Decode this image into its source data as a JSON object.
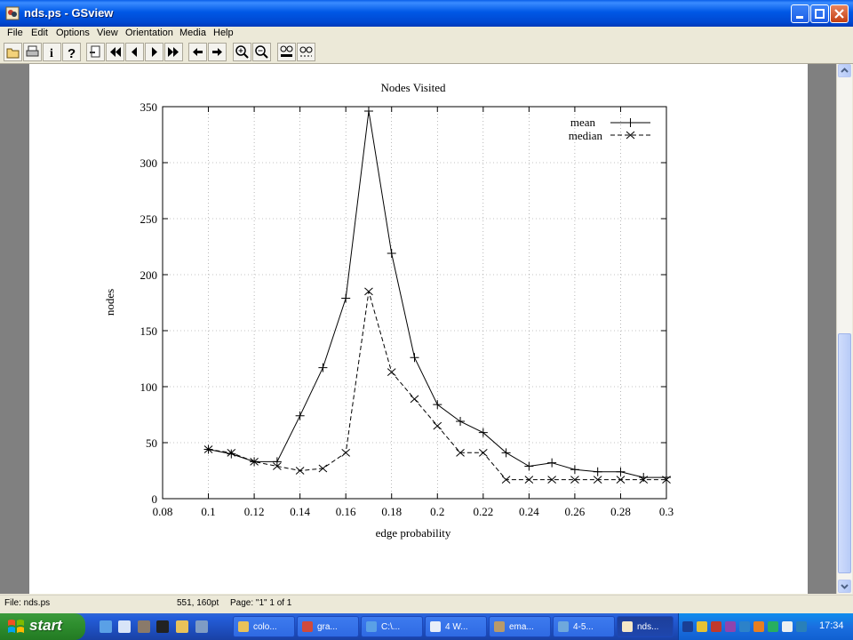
{
  "window": {
    "title": "nds.ps - GSview",
    "menu": [
      "File",
      "Edit",
      "Options",
      "View",
      "Orientation",
      "Media",
      "Help"
    ],
    "toolbar_icons": [
      "open-icon",
      "print-icon",
      "info-icon",
      "help-icon",
      "goto-page-icon",
      "first-page-icon",
      "prev-page-icon",
      "next-page-icon",
      "last-page-icon",
      "back-icon",
      "forward-icon",
      "zoom-in-icon",
      "zoom-out-icon",
      "text-view-icon",
      "view-icon"
    ]
  },
  "chart_data": {
    "type": "line",
    "title": "Nodes Visited",
    "xlabel": "edge probability",
    "ylabel": "nodes",
    "xlim": [
      0.08,
      0.3
    ],
    "ylim": [
      0,
      350
    ],
    "xticks": [
      "0.08",
      "0.1",
      "0.12",
      "0.14",
      "0.16",
      "0.18",
      "0.2",
      "0.22",
      "0.24",
      "0.26",
      "0.28",
      "0.3"
    ],
    "yticks": [
      "0",
      "50",
      "100",
      "150",
      "200",
      "250",
      "300",
      "350"
    ],
    "grid": true,
    "legend_position": "top-right",
    "x": [
      0.1,
      0.11,
      0.12,
      0.13,
      0.14,
      0.15,
      0.16,
      0.17,
      0.18,
      0.19,
      0.2,
      0.21,
      0.22,
      0.23,
      0.24,
      0.25,
      0.26,
      0.27,
      0.28,
      0.29,
      0.3
    ],
    "series": [
      {
        "name": "mean",
        "marker": "plus",
        "dash": "solid",
        "values": [
          44,
          40,
          33,
          33,
          74,
          117,
          179,
          346,
          219,
          126,
          84,
          69,
          59,
          41,
          29,
          32,
          26,
          24,
          24,
          19,
          19
        ]
      },
      {
        "name": "median",
        "marker": "x",
        "dash": "dashed",
        "values": [
          44,
          41,
          33,
          29,
          25,
          27,
          41,
          185,
          113,
          89,
          65,
          41,
          41,
          17,
          17,
          17,
          17,
          17,
          17,
          17,
          17
        ]
      }
    ]
  },
  "status": {
    "file": "File: nds.ps",
    "coords": "551, 160pt",
    "page": "Page: \"1\"  1 of 1"
  },
  "taskbar": {
    "start_label": "start",
    "items": [
      "colo...",
      "gra...",
      "C:\\...",
      "4 W...",
      "ema...",
      "4-5...",
      "nds..."
    ],
    "clock": "17:34"
  }
}
